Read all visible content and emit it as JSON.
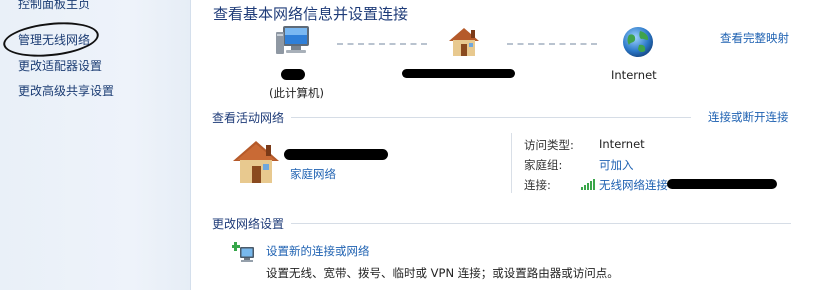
{
  "sidebar": {
    "items": [
      {
        "label": "控制面板主页"
      },
      {
        "label": "管理无线网络"
      },
      {
        "label": "更改适配器设置"
      },
      {
        "label": "更改高级共享设置"
      }
    ]
  },
  "main": {
    "title": "查看基本网络信息并设置连接",
    "full_map_link": "查看完整映射",
    "map": {
      "computer_sub_label": "(此计算机)",
      "internet_label": "Internet"
    },
    "active_networks": {
      "title": "查看活动网络",
      "connect_disconnect_link": "连接或断开连接",
      "network_type": "家庭网络",
      "access_type_label": "访问类型:",
      "access_type_value": "Internet",
      "homegroup_label": "家庭组:",
      "homegroup_value": "可加入",
      "connection_label": "连接:",
      "connection_value": "无线网络连接"
    },
    "change_settings": {
      "title": "更改网络设置",
      "setup_link": "设置新的连接或网络",
      "setup_desc": "设置无线、宽带、拨号、临时或 VPN 连接；或设置路由器或访问点。"
    }
  },
  "colors": {
    "link": "#1f62b2",
    "title": "#1e3b78",
    "sidebar_bg": "#eef3fa"
  }
}
